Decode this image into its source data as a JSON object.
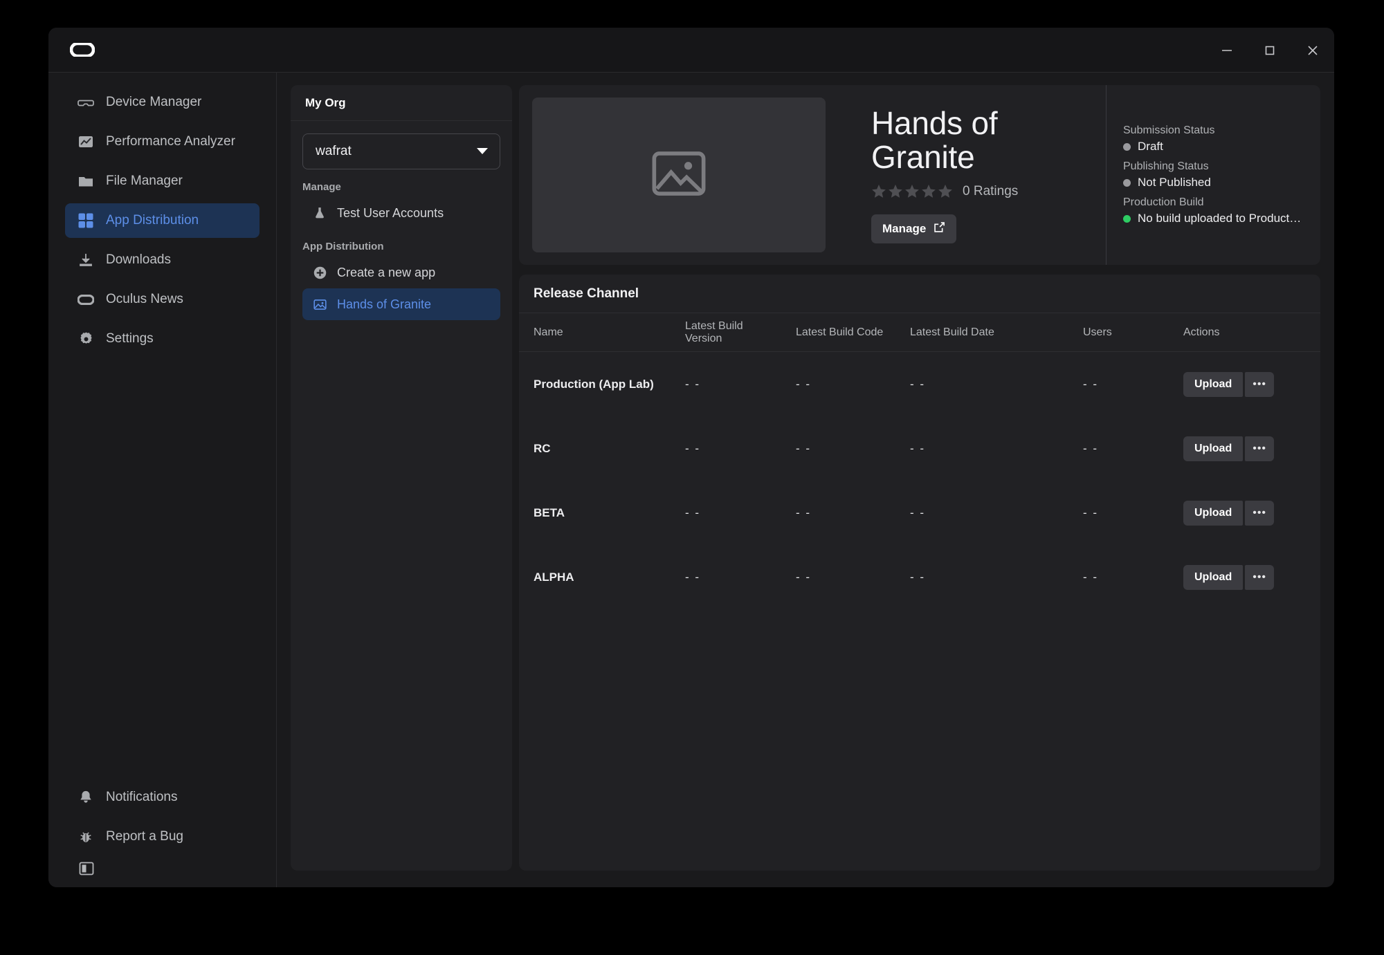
{
  "window": {
    "logo_name": "oculus-logo",
    "controls": {
      "minimize": "–",
      "maximize": "□",
      "close": "✕"
    }
  },
  "sidebar": {
    "items": [
      {
        "label": "Device Manager",
        "icon": "headset-icon",
        "active": false
      },
      {
        "label": "Performance Analyzer",
        "icon": "chart-icon",
        "active": false
      },
      {
        "label": "File Manager",
        "icon": "folder-icon",
        "active": false
      },
      {
        "label": "App Distribution",
        "icon": "grid-icon",
        "active": true
      },
      {
        "label": "Downloads",
        "icon": "download-icon",
        "active": false
      },
      {
        "label": "Oculus News",
        "icon": "oculus-icon",
        "active": false
      },
      {
        "label": "Settings",
        "icon": "gear-icon",
        "active": false
      }
    ],
    "bottom_items": [
      {
        "label": "Notifications",
        "icon": "bell-icon"
      },
      {
        "label": "Report a Bug",
        "icon": "bug-icon"
      }
    ],
    "collapse_icon": "collapse-panel-icon"
  },
  "org_panel": {
    "header": "My Org",
    "org_select": {
      "value": "wafrat",
      "chevron": "chevron-down-icon"
    },
    "manage_label": "Manage",
    "manage_items": [
      {
        "label": "Test User Accounts",
        "icon": "flask-icon",
        "active": false
      }
    ],
    "app_distribution_label": "App Distribution",
    "app_items": [
      {
        "label": "Create a new app",
        "icon": "plus-circle-icon",
        "active": false
      },
      {
        "label": "Hands of Granite",
        "icon": "image-icon",
        "active": true
      }
    ]
  },
  "app": {
    "thumbnail_icon": "image-placeholder-icon",
    "title": "Hands of Granite",
    "stars": 0,
    "star_total": 5,
    "ratings_text": "0 Ratings",
    "manage_button": "Manage",
    "manage_icon": "external-link-icon",
    "status": [
      {
        "label": "Submission Status",
        "value": "Draft",
        "color": "#9a9a9e"
      },
      {
        "label": "Publishing Status",
        "value": "Not Published",
        "color": "#9a9a9e"
      },
      {
        "label": "Production Build",
        "value": "No build uploaded to Product…",
        "color": "#2ecc63"
      }
    ]
  },
  "release_channel": {
    "title": "Release Channel",
    "columns": [
      "Name",
      "Latest Build\nVersion",
      "Latest Build Code",
      "Latest Build Date",
      "Users",
      "Actions"
    ],
    "column_labels": {
      "name": "Name",
      "version_line1": "Latest Build",
      "version_line2": "Version",
      "code": "Latest Build Code",
      "date": "Latest Build Date",
      "users": "Users",
      "actions": "Actions"
    },
    "empty_value": "- -",
    "upload_label": "Upload",
    "more_label": "•••",
    "rows": [
      {
        "name": "Production (App Lab)",
        "version": "- -",
        "code": "- -",
        "date": "- -",
        "users": "- -"
      },
      {
        "name": "RC",
        "version": "- -",
        "code": "- -",
        "date": "- -",
        "users": "- -"
      },
      {
        "name": "BETA",
        "version": "- -",
        "code": "- -",
        "date": "- -",
        "users": "- -"
      },
      {
        "name": "ALPHA",
        "version": "- -",
        "code": "- -",
        "date": "- -",
        "users": "- -"
      }
    ]
  },
  "colors": {
    "accent_blue": "#5d8fe8",
    "accent_bg": "#1d3354",
    "status_green": "#2ecc63",
    "status_gray": "#9a9a9e",
    "window_bg": "#1a1a1c",
    "card_bg": "#212124"
  }
}
